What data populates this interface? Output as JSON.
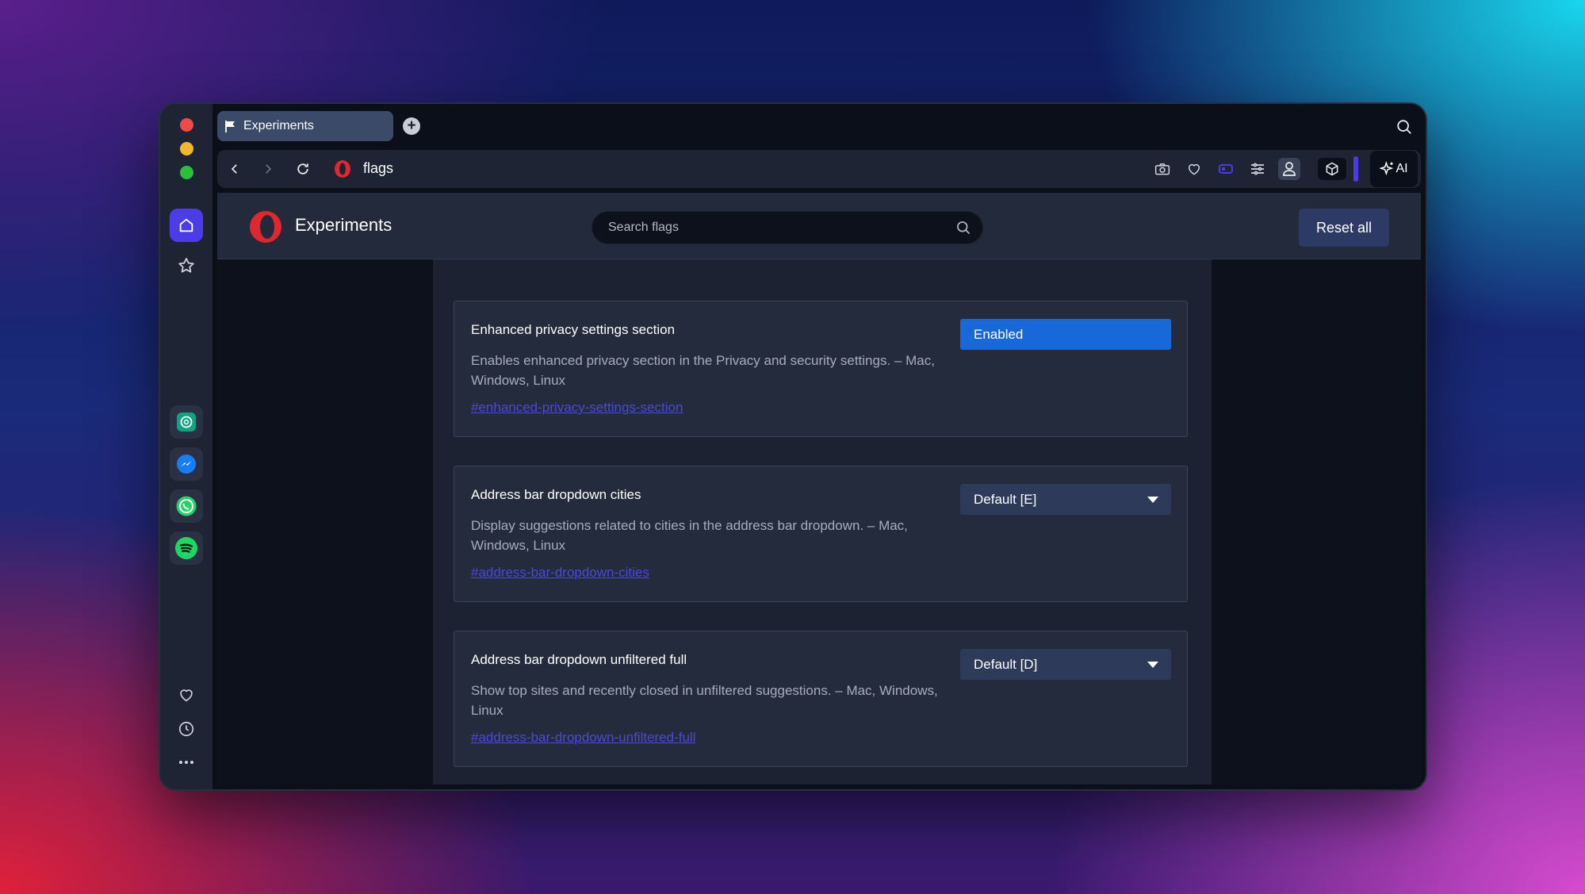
{
  "tab": {
    "label": "Experiments",
    "icon": "flag-icon"
  },
  "address_bar": {
    "url": "flags"
  },
  "page": {
    "title": "Experiments",
    "search_placeholder": "Search flags",
    "reset_label": "Reset all"
  },
  "flags": [
    {
      "title": "Enhanced privacy settings section",
      "description": "Enables enhanced privacy section in the Privacy and security settings. – Mac, Windows, Linux",
      "link": "#enhanced-privacy-settings-section",
      "value": "Enabled"
    },
    {
      "title": "Address bar dropdown cities",
      "description": "Display suggestions related to cities in the address bar dropdown. – Mac, Windows, Linux",
      "link": "#address-bar-dropdown-cities",
      "value": "Default [E]"
    },
    {
      "title": "Address bar dropdown unfiltered full",
      "description": "Show top sites and recently closed in unfiltered suggestions. – Mac, Windows, Linux",
      "link": "#address-bar-dropdown-unfiltered-full",
      "value": "Default [D]"
    }
  ],
  "toolbar": {
    "ai_label": "AI"
  },
  "colors": {
    "accent": "#4b3ce8",
    "enabled_select": "#1768d8",
    "link": "#4a49d8",
    "opera_red": "#e0262f"
  }
}
